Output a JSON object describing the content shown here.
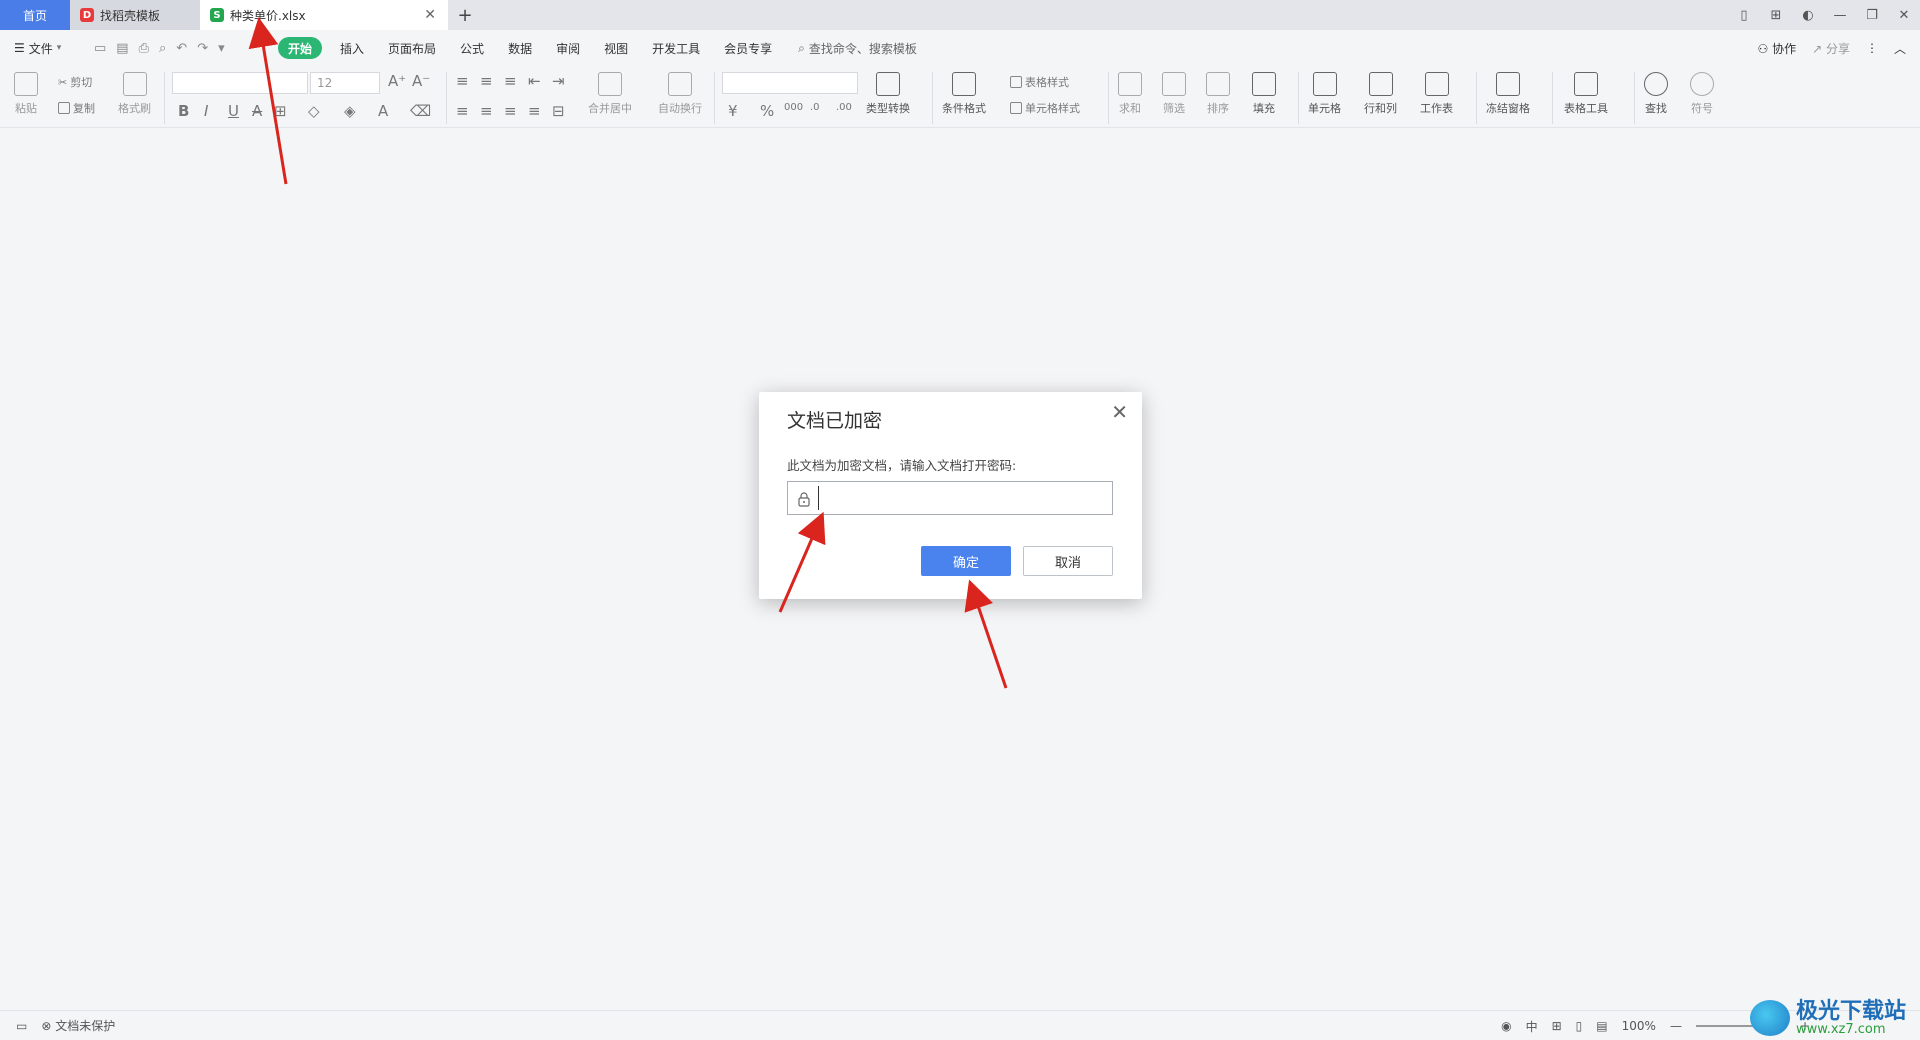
{
  "tabs": [
    {
      "label": "首页"
    },
    {
      "label": "找稻壳模板"
    },
    {
      "label": "种类单价.xlsx"
    }
  ],
  "tab_add_label": "+",
  "menu": {
    "file_label": "文件",
    "ribbon_tabs": [
      "开始",
      "插入",
      "页面布局",
      "公式",
      "数据",
      "审阅",
      "视图",
      "开发工具",
      "会员专享"
    ],
    "search_placeholder": "查找命令、搜索模板",
    "collab_label": "协作",
    "share_label": "分享"
  },
  "ribbon": {
    "paste": "粘贴",
    "cut": "剪切",
    "copy": "复制",
    "format_painter": "格式刷",
    "font_size": "12",
    "merge_center": "合并居中",
    "wrap_text": "自动换行",
    "type_convert": "类型转换",
    "conditional_format": "条件格式",
    "table_style": "表格样式",
    "cell_style": "单元格样式",
    "sum": "求和",
    "filter": "筛选",
    "sort": "排序",
    "fill": "填充",
    "cell": "单元格",
    "row_col": "行和列",
    "worksheet": "工作表",
    "freeze": "冻结窗格",
    "table_tools": "表格工具",
    "find": "查找",
    "symbol": "符号"
  },
  "dialog": {
    "title": "文档已加密",
    "message": "此文档为加密文档，请输入文档打开密码:",
    "password_value": "",
    "ok_label": "确定",
    "cancel_label": "取消"
  },
  "status": {
    "protect_label": "文档未保护",
    "input_mode": "中",
    "zoom": "100%"
  },
  "watermark": {
    "main": "极光下载站",
    "sub": "www.xz7.com"
  },
  "colors": {
    "accent_blue": "#4a82ee",
    "ribbon_active_green": "#2bb673",
    "arrow_red": "#d9251d"
  }
}
